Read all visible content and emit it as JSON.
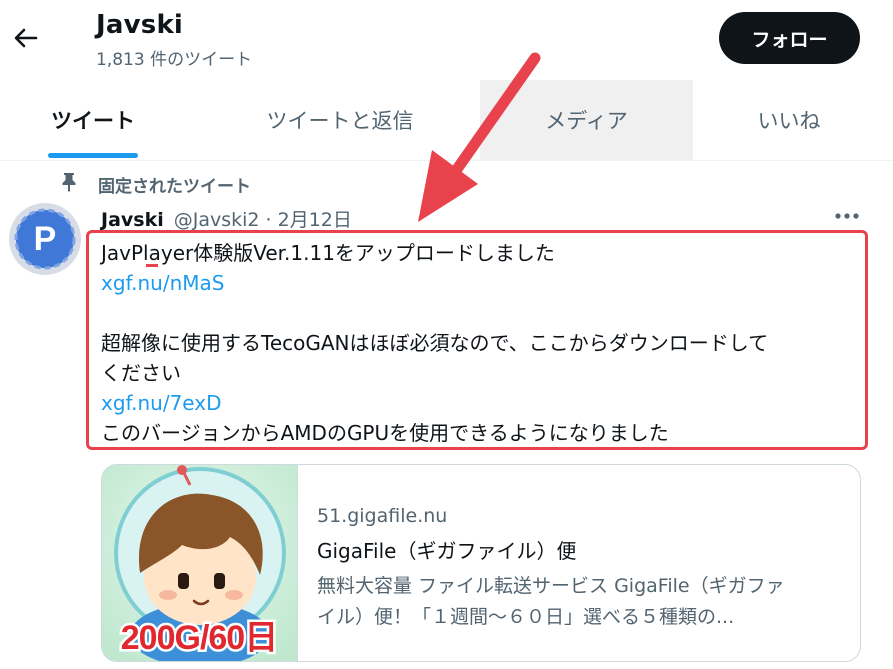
{
  "header": {
    "name": "Javski",
    "tweet_count": "1,813 件のツイート",
    "follow_label": "フォロー"
  },
  "tabs": [
    {
      "label": "ツイート"
    },
    {
      "label": "ツイートと返信"
    },
    {
      "label": "メディア"
    },
    {
      "label": "いいね"
    }
  ],
  "pinned_label": "固定されたツイート",
  "avatar_letter": "P",
  "tweet": {
    "name": "Javski",
    "handle_date": "@Javski2 · 2月12日",
    "lines": [
      "JavPlayer体験版Ver.1.11をアップロードしました",
      "xgf.nu/nMaS",
      "",
      "超解像に使用するTecoGANはほぼ必須なので、ここからダウンロードして",
      "ください",
      "xgf.nu/7exD",
      "このバージョンからAMDのGPUを使用できるようになりました"
    ]
  },
  "card": {
    "domain": "51.gigafile.nu",
    "title": "GigaFile（ギガファイル）便",
    "desc_line1": "無料大容量 ファイル転送サービス GigaFile（ギガファ",
    "desc_line2": "イル）便！「１週間～６０日」選べる５種類の...",
    "thumb_text": "200G/60日"
  },
  "colors": {
    "accent": "#1d9bf0",
    "annotation_red": "#e8424c",
    "follow_bg": "#0f1419"
  }
}
